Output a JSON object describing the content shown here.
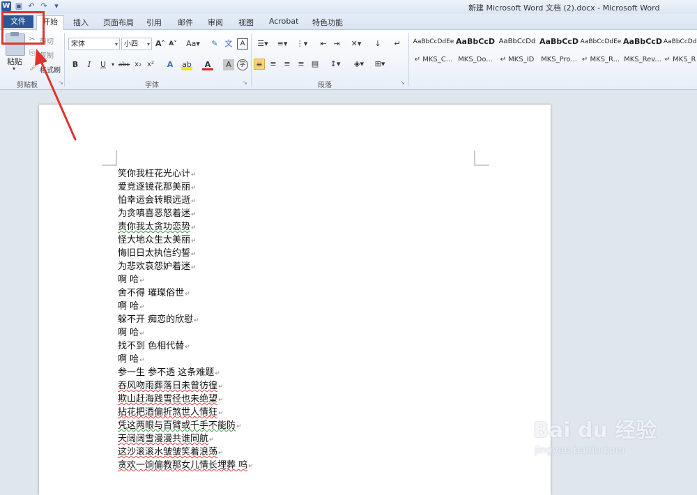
{
  "window": {
    "title": "新建 Microsoft Word 文档 (2).docx - Microsoft Word"
  },
  "tabs": {
    "file": "文件",
    "items": [
      "开始",
      "插入",
      "页面布局",
      "引用",
      "邮件",
      "审阅",
      "视图",
      "Acrobat",
      "特色功能"
    ],
    "active": "开始"
  },
  "clipboard": {
    "paste": "粘贴",
    "cut": "剪切",
    "copy": "复制",
    "format_painter": "格式刷",
    "group_label": "剪贴板"
  },
  "font": {
    "family": "宋体",
    "size": "小四",
    "group_label": "字体",
    "buttons": [
      "B",
      "I",
      "U",
      "abc",
      "x₂",
      "x²"
    ]
  },
  "paragraph": {
    "group_label": "段落"
  },
  "styles": [
    {
      "sample": "AaBbCcDdEe",
      "name": "↵ MKS_C...",
      "bold": false
    },
    {
      "sample": "AaBbCcD",
      "name": "MKS_Do...",
      "bold": true
    },
    {
      "sample": "AaBbCcDd",
      "name": "↵ MKS_ID",
      "bold": false
    },
    {
      "sample": "AaBbCcD",
      "name": "MKS_Pro...",
      "bold": true
    },
    {
      "sample": "AaBbCcDdEe",
      "name": "↵ MKS_R...",
      "bold": false
    },
    {
      "sample": "AaBbCcD",
      "name": "MKS_Rev...",
      "bold": true
    },
    {
      "sample": "AaBbCcDdEe",
      "name": "↵ MKS_R",
      "bold": false
    }
  ],
  "document": {
    "lines": [
      "笑你我枉花光心计",
      "爱竞逐镜花那美丽",
      "怕幸运会转眼远逝",
      "为贪嗔喜恶怒着迷",
      "责你我太贪功恋势",
      "怪大地众生太美丽",
      "悔旧日太执信约誓",
      "为悲欢哀怨妒着迷",
      "啊  哈",
      "舍不得  璀璨俗世",
      "啊  哈",
      "躲不开  痴恋的欣慰",
      "啊  哈",
      "找不到  色相代替",
      "啊  哈",
      "参一生  参不透  这条难题",
      "吞风吻雨葬落日未曾彷徨",
      "欺山赶海践雪径也未绝望",
      "拈花把酒偏折煞世人情狂",
      "凭这两眼与百臂或千手不能防",
      "天阔阔雪漫漫共谁同航",
      "这沙滚滚水皱皱笑着浪荡",
      "贪欢一饷偏教那女儿情长埋葬  呜"
    ]
  },
  "watermark": {
    "brand": "Bai du 经验",
    "url": "jingyan.baidu.com"
  }
}
